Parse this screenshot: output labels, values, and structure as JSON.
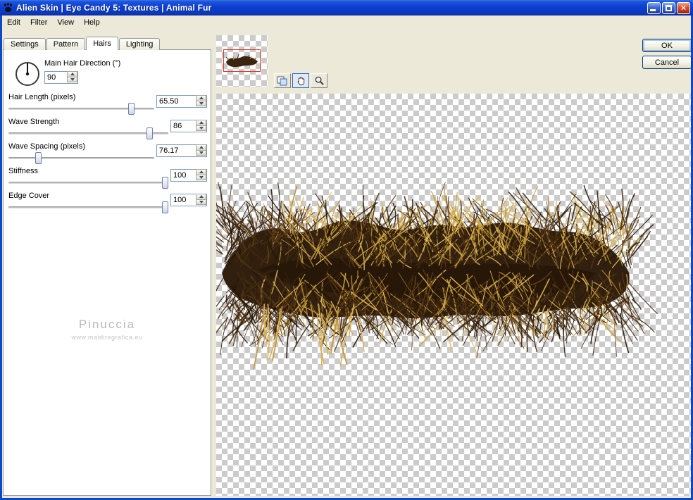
{
  "window": {
    "title": "Alien Skin | Eye Candy 5: Textures | Animal Fur",
    "icons": {
      "close_glyph": "×"
    }
  },
  "menu": {
    "items": [
      {
        "label": "Edit"
      },
      {
        "label": "Filter"
      },
      {
        "label": "View"
      },
      {
        "label": "Help"
      }
    ]
  },
  "tabs": {
    "items": [
      {
        "label": "Settings",
        "active": false
      },
      {
        "label": "Pattern",
        "active": false
      },
      {
        "label": "Hairs",
        "active": true
      },
      {
        "label": "Lighting",
        "active": false
      }
    ]
  },
  "panel": {
    "direction": {
      "label": "Main Hair Direction (°)",
      "value": "90"
    },
    "sliders": [
      {
        "label": "Hair Length (pixels)",
        "value": "65.50",
        "pct": 0.86
      },
      {
        "label": "Wave Strength",
        "value": "86",
        "pct": 0.9
      },
      {
        "label": "Wave Spacing (pixels)",
        "value": "76.17",
        "pct": 0.19
      },
      {
        "label": "Stiffness",
        "value": "100",
        "pct": 1
      },
      {
        "label": "Edge Cover",
        "value": "100",
        "pct": 1
      }
    ],
    "watermark": {
      "name": "Pinuccia",
      "url": "www.maidiregrafica.eu"
    }
  },
  "toolbar": {
    "buttons": [
      {
        "name": "preview-proof"
      },
      {
        "name": "pan-hand"
      },
      {
        "name": "zoom-magnifier"
      }
    ]
  },
  "actions": {
    "ok": "OK",
    "cancel": "Cancel"
  },
  "colors": {
    "titlebar_blue": "#0d3ecf",
    "dialog_bg": "#ECE9D8",
    "checker_gray": "#cbcbcb",
    "selection_red": "#e2392b",
    "fur_dark_brown": "#311d0b",
    "fur_gold": "#d9b04a"
  }
}
